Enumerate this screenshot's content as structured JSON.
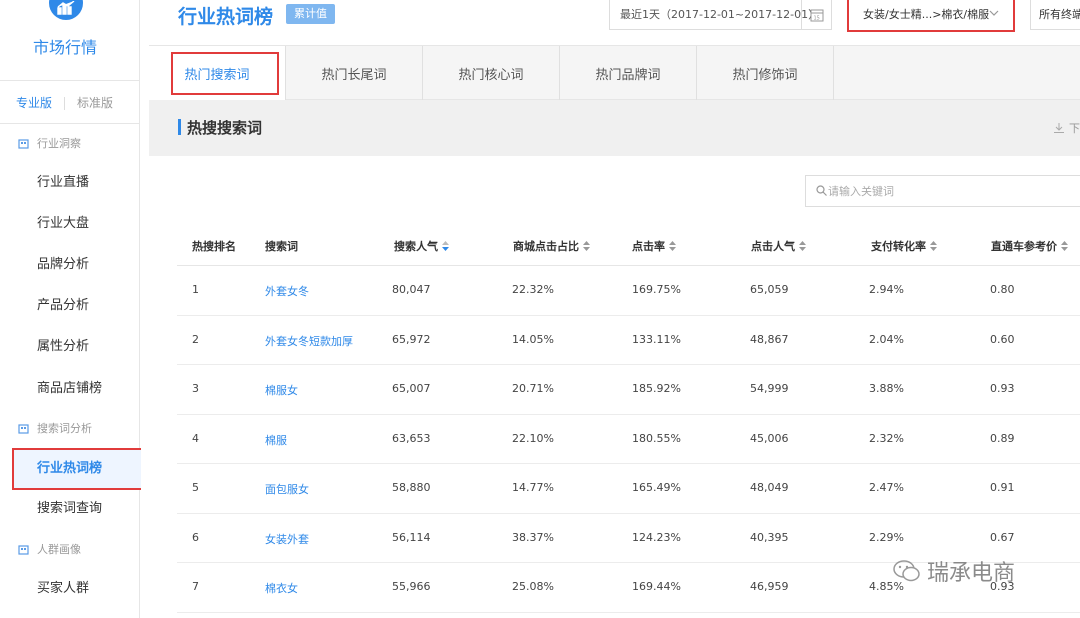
{
  "sidebar": {
    "brand": "市场行情",
    "version_pro": "专业版",
    "version_std": "标准版",
    "sections": [
      {
        "title": "行业洞察",
        "items": [
          "行业直播",
          "行业大盘",
          "品牌分析",
          "产品分析",
          "属性分析",
          "商品店铺榜"
        ]
      },
      {
        "title": "搜索词分析",
        "items": [
          "行业热词榜",
          "搜索词查询"
        ]
      },
      {
        "title": "人群画像",
        "items": [
          "买家人群"
        ]
      }
    ],
    "active_item": "行业热词榜"
  },
  "header": {
    "title": "行业热词榜",
    "tag": "累计值",
    "date_range": "最近1天（2017-12-01~2017-12-01）",
    "category": "女装/女士精...>棉衣/棉服",
    "terminal": "所有终端"
  },
  "tabs": [
    "热门搜索词",
    "热门长尾词",
    "热门核心词",
    "热门品牌词",
    "热门修饰词"
  ],
  "active_tab": "热门搜索词",
  "section_title": "热搜搜索词",
  "download_label": "下",
  "search": {
    "placeholder": "请输入关键词"
  },
  "table": {
    "headers": [
      "热搜排名",
      "搜索词",
      "搜索人气",
      "商城点击占比",
      "点击率",
      "点击人气",
      "支付转化率",
      "直通车参考价"
    ],
    "rows": [
      [
        "1",
        "外套女冬",
        "80,047",
        "22.32%",
        "169.75%",
        "65,059",
        "2.94%",
        "0.80"
      ],
      [
        "2",
        "外套女冬短款加厚",
        "65,972",
        "14.05%",
        "133.11%",
        "48,867",
        "2.04%",
        "0.60"
      ],
      [
        "3",
        "棉服女",
        "65,007",
        "20.71%",
        "185.92%",
        "54,999",
        "3.88%",
        "0.93"
      ],
      [
        "4",
        "棉服",
        "63,653",
        "22.10%",
        "180.55%",
        "45,006",
        "2.32%",
        "0.89"
      ],
      [
        "5",
        "面包服女",
        "58,880",
        "14.77%",
        "165.49%",
        "48,049",
        "2.47%",
        "0.91"
      ],
      [
        "6",
        "女装外套",
        "56,114",
        "38.37%",
        "124.23%",
        "40,395",
        "2.29%",
        "0.67"
      ],
      [
        "7",
        "棉衣女",
        "55,966",
        "25.08%",
        "169.44%",
        "46,959",
        "4.85%",
        "0.93"
      ]
    ]
  },
  "watermark": "瑞承电商",
  "colors": {
    "accent": "#2f89e8",
    "highlight": "#e13b3b",
    "tag_bg": "#7fb7f0"
  }
}
